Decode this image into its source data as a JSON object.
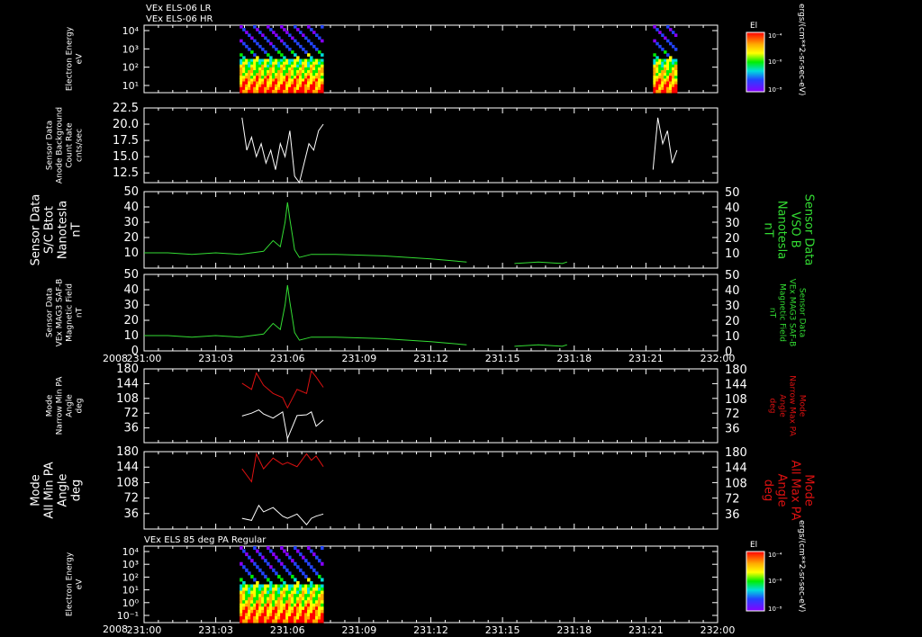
{
  "chart_data": {
    "type": "line",
    "titles": {
      "top1": "VEx ELS-06 LR",
      "top2": "VEx ELS-06 HR",
      "bottom": "VEx ELS 85 deg PA Regular"
    },
    "year": "2008",
    "time_ticks": [
      "231:00",
      "231:03",
      "231:06",
      "231:09",
      "231:12",
      "231:15",
      "231:18",
      "231:21",
      "232:00"
    ],
    "colors": {
      "white": "#ffffff",
      "green": "#33dd33",
      "red": "#dd1111",
      "background": "#000000"
    },
    "colorbar_top": {
      "title": "El",
      "ticks": [
        "10⁻⁴",
        "10⁻⁶",
        "10⁻⁸"
      ],
      "unit": "ergs/(cm**2-sr-sec-eV)"
    },
    "colorbar_bottom": {
      "title": "El",
      "ticks": [
        "10⁻⁴",
        "10⁻⁶",
        "10⁻⁸"
      ],
      "unit": "ergs/(cm**2-sr-sec-eV)"
    },
    "panels": [
      {
        "id": "electron_energy_top",
        "type": "heatmap",
        "ylabel": [
          "Electron Energy",
          "eV"
        ],
        "scale": "log",
        "yticks": [
          "10⁴",
          "10³",
          "10²",
          "10¹"
        ],
        "data_ranges": [
          [
            231.04,
            231.075
          ],
          [
            231.213,
            231.223
          ]
        ]
      },
      {
        "id": "anode_background",
        "type": "line",
        "ylabel": [
          "Sensor Data",
          "Anode Background",
          "Count Rate",
          "cnts/sec"
        ],
        "ylim": [
          11,
          22.5
        ],
        "yticks": [
          "22.5",
          "20.0",
          "17.5",
          "15.0",
          "12.5"
        ],
        "color": "white",
        "series": [
          {
            "x": [
              231.041,
              231.043,
              231.045,
              231.047,
              231.049,
              231.051,
              231.053,
              231.055,
              231.057,
              231.059,
              231.061,
              231.063,
              231.065,
              231.067,
              231.069,
              231.071,
              231.073,
              231.075
            ],
            "y": [
              21,
              16,
              18,
              15,
              17,
              14,
              16,
              13,
              17,
              15,
              19,
              12,
              11,
              14,
              17,
              16,
              19,
              20
            ]
          },
          {
            "x": [
              231.213,
              231.215,
              231.217,
              231.219,
              231.221,
              231.223
            ],
            "y": [
              13,
              21,
              17,
              19,
              14,
              16
            ]
          }
        ]
      },
      {
        "id": "bmag_vso",
        "type": "line",
        "ylabel": [
          "Sensor Data",
          "S/C Btot",
          "Nanotesla",
          "nT"
        ],
        "rlabel": [
          "Sensor Data",
          "VSO B",
          "Nanotesla",
          "nT"
        ],
        "ylim": [
          0,
          50
        ],
        "yticks": [
          "50",
          "40",
          "30",
          "20",
          "10"
        ],
        "color": "green",
        "series": [
          {
            "x": [
              231.0,
              231.01,
              231.02,
              231.03,
              231.04,
              231.05,
              231.054,
              231.057,
              231.059,
              231.06,
              231.061,
              231.062,
              231.063,
              231.065,
              231.07,
              231.08,
              231.1,
              231.12,
              231.135
            ],
            "y": [
              10,
              10,
              9,
              10,
              9,
              11,
              18,
              14,
              30,
              43,
              32,
              22,
              12,
              7,
              9,
              9,
              8,
              6,
              4
            ]
          },
          {
            "x": [
              231.155,
              231.165,
              231.175,
              231.177
            ],
            "y": [
              3,
              4,
              3,
              4
            ]
          }
        ]
      },
      {
        "id": "mag_saf",
        "type": "line",
        "ylabel": [
          "Sensor Data",
          "VEx MAG3 SAF-B",
          "Magnetic Field",
          "nT"
        ],
        "rlabel": [
          "Sensor Data",
          "VEx MAG3 SAF-B",
          "Magnetic Field",
          "nT"
        ],
        "ylim": [
          0,
          50
        ],
        "yticks": [
          "50",
          "40",
          "30",
          "20",
          "10",
          "0"
        ],
        "color": "green",
        "series": [
          {
            "x": [
              231.0,
              231.01,
              231.02,
              231.03,
              231.04,
              231.05,
              231.054,
              231.057,
              231.059,
              231.06,
              231.061,
              231.062,
              231.063,
              231.065,
              231.07,
              231.08,
              231.1,
              231.12,
              231.135
            ],
            "y": [
              10,
              10,
              9,
              10,
              9,
              11,
              18,
              14,
              30,
              43,
              32,
              22,
              12,
              7,
              9,
              9,
              8,
              6,
              4
            ]
          },
          {
            "x": [
              231.155,
              231.165,
              231.175,
              231.177
            ],
            "y": [
              3,
              4,
              3,
              4
            ]
          }
        ]
      },
      {
        "id": "narrow_pa",
        "type": "line",
        "ylabel": [
          "Mode",
          "Narrow Min PA",
          "Angle",
          "deg"
        ],
        "rlabel": [
          "Mode",
          "Narrow Max PA",
          "Angle",
          "deg"
        ],
        "ylim": [
          0,
          180
        ],
        "yticks": [
          "180",
          "144",
          "108",
          "72",
          "36"
        ],
        "colors": [
          "white",
          "red"
        ],
        "series": [
          {
            "name": "min",
            "x": [
              231.041,
              231.045,
              231.048,
              231.05,
              231.054,
              231.058,
              231.06,
              231.064,
              231.068,
              231.07,
              231.072,
              231.075
            ],
            "y": [
              65,
              72,
              80,
              70,
              60,
              75,
              10,
              66,
              68,
              75,
              40,
              55
            ]
          },
          {
            "name": "max",
            "x": [
              231.041,
              231.045,
              231.047,
              231.05,
              231.054,
              231.058,
              231.06,
              231.064,
              231.068,
              231.07,
              231.072,
              231.075
            ],
            "y": [
              145,
              130,
              170,
              140,
              120,
              110,
              85,
              130,
              120,
              175,
              160,
              135
            ]
          }
        ]
      },
      {
        "id": "all_pa",
        "type": "line",
        "ylabel": [
          "Mode",
          "All Min PA",
          "Angle",
          "deg"
        ],
        "rlabel": [
          "Mode",
          "All Max PA",
          "Angle",
          "deg"
        ],
        "ylim": [
          0,
          180
        ],
        "yticks": [
          "180",
          "144",
          "108",
          "72",
          "36"
        ],
        "colors": [
          "white",
          "red"
        ],
        "series": [
          {
            "name": "min",
            "x": [
              231.041,
              231.045,
              231.048,
              231.05,
              231.054,
              231.058,
              231.06,
              231.064,
              231.068,
              231.07,
              231.072,
              231.075
            ],
            "y": [
              25,
              20,
              55,
              40,
              50,
              30,
              25,
              35,
              10,
              25,
              30,
              35
            ]
          },
          {
            "name": "max",
            "x": [
              231.041,
              231.045,
              231.047,
              231.05,
              231.054,
              231.058,
              231.06,
              231.064,
              231.068,
              231.07,
              231.072,
              231.075
            ],
            "y": [
              140,
              110,
              175,
              140,
              165,
              150,
              155,
              145,
              175,
              160,
              170,
              145
            ]
          }
        ]
      },
      {
        "id": "electron_energy_bottom",
        "type": "heatmap",
        "ylabel": [
          "Electron Energy",
          "eV"
        ],
        "scale": "log",
        "yticks": [
          "10⁴",
          "10³",
          "10²",
          "10¹",
          "10⁰",
          "10⁻¹"
        ],
        "data_ranges": [
          [
            231.04,
            231.075
          ]
        ]
      }
    ]
  }
}
